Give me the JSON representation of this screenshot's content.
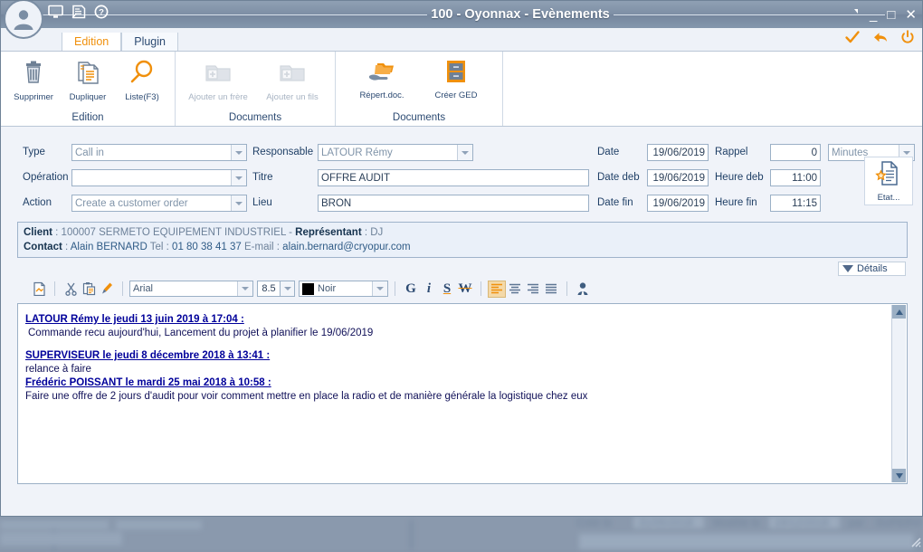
{
  "window": {
    "title": "100 - Oyonnax - Evènements",
    "titlebar_icons": [
      "avatar-icon",
      "monitor-icon",
      "form-icon",
      "help-icon"
    ],
    "controls": {
      "restore": "restore-icon",
      "minimize": "_",
      "maximize": "□",
      "close": "✕"
    }
  },
  "tabs": [
    {
      "label": "Edition",
      "active": true
    },
    {
      "label": "Plugin",
      "active": false
    }
  ],
  "tab_actions": [
    "validate-check-icon",
    "undo-arrow-icon",
    "power-icon"
  ],
  "ribbon": {
    "groups": [
      {
        "title": "Edition",
        "buttons": [
          {
            "label": "Supprimer",
            "icon": "trash-icon",
            "disabled": false
          },
          {
            "label": "Dupliquer",
            "icon": "duplicate-document-icon",
            "disabled": false
          },
          {
            "label": "Liste(F3)",
            "icon": "magnifier-icon",
            "disabled": false
          }
        ]
      },
      {
        "title": "Documents",
        "buttons": [
          {
            "label": "Ajouter un frère",
            "icon": "add-folder-icon",
            "disabled": true
          },
          {
            "label": "Ajouter un  fils",
            "icon": "add-folder-icon",
            "disabled": true
          }
        ]
      },
      {
        "title": "Documents",
        "buttons": [
          {
            "label": "Répert.doc.",
            "icon": "hand-folder-icon",
            "disabled": false
          },
          {
            "label": "Créer GED",
            "icon": "file-cabinet-icon",
            "disabled": false
          }
        ]
      }
    ]
  },
  "form": {
    "type": {
      "label": "Type",
      "value": "Call in"
    },
    "operation": {
      "label": "Opération",
      "value": ""
    },
    "action": {
      "label": "Action",
      "value": "Create a customer order"
    },
    "responsable": {
      "label": "Responsable",
      "value": "LATOUR Rémy"
    },
    "titre": {
      "label": "Titre",
      "value": "OFFRE AUDIT"
    },
    "lieu": {
      "label": "Lieu",
      "value": "BRON"
    },
    "date": {
      "label": "Date",
      "value": "19/06/2019"
    },
    "date_deb": {
      "label": "Date deb",
      "value": "19/06/2019"
    },
    "date_fin": {
      "label": "Date fin",
      "value": "19/06/2019"
    },
    "rappel": {
      "label": "Rappel",
      "value": "0"
    },
    "rappel_unit": {
      "value": "Minutes"
    },
    "heure_deb": {
      "label": "Heure deb",
      "value": "11:00"
    },
    "heure_fin": {
      "label": "Heure fin",
      "value": "11:15"
    },
    "etat_button": {
      "label": "Etat...",
      "icon": "state-document-star-icon"
    }
  },
  "client_panel": {
    "client_label": "Client",
    "client_sep": " : ",
    "client_value": "100007 SERMETO EQUIPEMENT INDUSTRIEL",
    "dash": " - ",
    "representant_label": "Représentant",
    "representant_value": " : DJ",
    "contact_label": "Contact",
    "contact_value": " : ",
    "contact_name": "Alain BERNARD",
    "tel_label": "  Tel : ",
    "tel_value": "01 80 38 41 37",
    "email_label": "  E-mail : ",
    "email_value": "alain.bernard@cryopur.com"
  },
  "details_toggle": {
    "label": "Détails",
    "icon": "chevron-down-icon"
  },
  "editor_toolbar": {
    "font": "Arial",
    "size": "8.5",
    "color_name": "Noir",
    "color_hex": "#000000",
    "buttons": [
      "insert-document-icon",
      "cut-icon",
      "paste-icon",
      "format-painter-icon",
      "bold-icon",
      "italic-icon",
      "underline-icon",
      "strikethrough-icon",
      "align-left-icon",
      "align-center-icon",
      "align-right-icon",
      "align-justify-icon",
      "signature-icon"
    ],
    "bold_glyph": "G",
    "italic_glyph": "i",
    "underline_glyph": "S",
    "strike_glyph": "W"
  },
  "notes": [
    {
      "header": "LATOUR Rémy le jeudi 13 juin 2019 à 17:04 :",
      "body": "Commande recu aujourd'hui, Lancement du projet à planifier le 19/06/2019",
      "gap_after": true
    },
    {
      "header": "SUPERVISEUR le jeudi 8 décembre 2018 à 13:41 :",
      "body": "relance à faire",
      "gap_after": false
    },
    {
      "header": "Frédéric POISSANT le mardi 25 mai 2018 à 10:58 :",
      "body": "Faire une offre de 2 jours d'audit pour voir comment mettre en place la radio et de manière générale la logistique chez eux",
      "gap_after": false
    }
  ],
  "background_window": {
    "fields": [
      "Créé le",
      "31/05/2018",
      "Modifié le",
      "19/12/2018",
      "par",
      "SUPERVI"
    ]
  },
  "colors": {
    "titlebar": "#7e8fa5",
    "accent_orange": "#f0900c",
    "form_bg": "#f0f3f9",
    "field_border": "#9bb0c6",
    "label_text": "#1f3f66",
    "note_header": "#00009a",
    "backdrop": "#8a99ad"
  }
}
